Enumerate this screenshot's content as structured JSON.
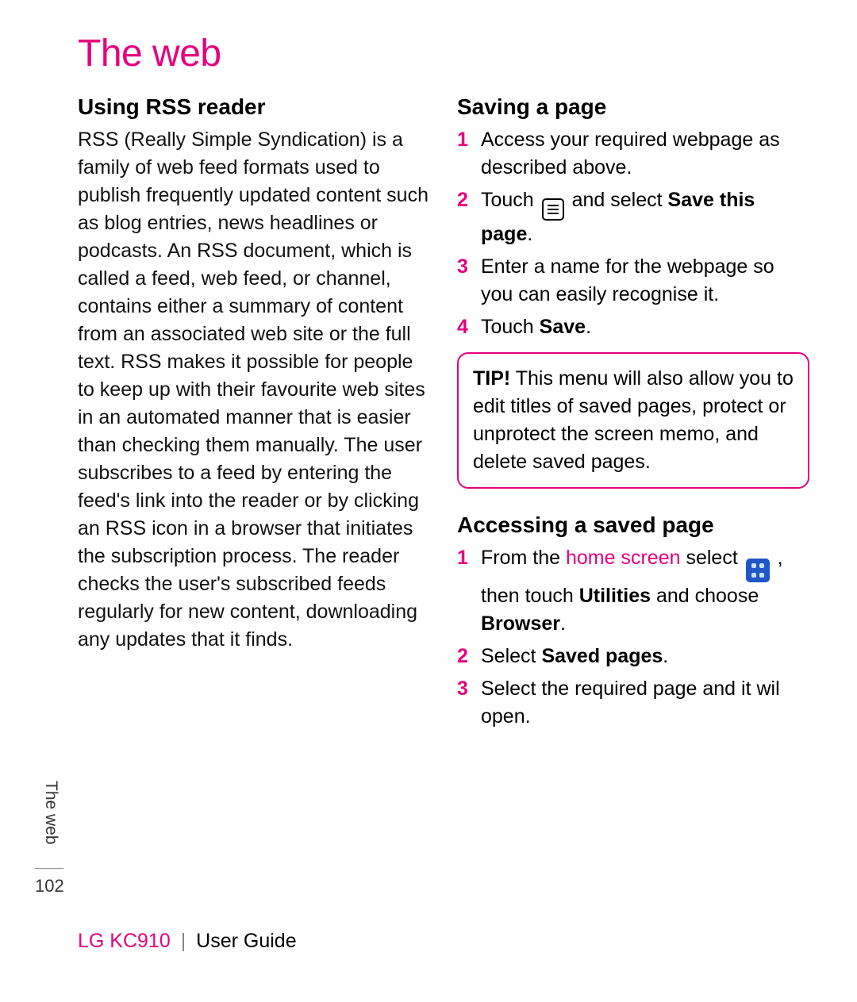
{
  "title": "The web",
  "side_label": "The web",
  "page_number": "102",
  "footer": {
    "model": "LG KC910",
    "separator": "|",
    "guide": "User Guide"
  },
  "left": {
    "heading": "Using RSS reader",
    "body": "RSS (Really Simple Syndication) is a family of web feed formats used to publish frequently updated content such as blog entries, news headlines or podcasts. An RSS document, which is called a feed, web feed, or channel, contains either a summary of content from an associated web site or the full text. RSS makes it possible for people to keep up with their favourite web sites in an automated manner that is easier than checking them manually. The user subscribes to a feed by entering the feed's link into the reader or by clicking an RSS icon in a browser that initiates the subscription process. The reader checks the user's subscribed feeds regularly for new content, downloading any updates that it finds."
  },
  "right": {
    "saving": {
      "heading": "Saving a page",
      "step1": "Access your required webpage as described above.",
      "step2_pre": "Touch ",
      "step2_mid": " and select ",
      "step2_bold": "Save this page",
      "step2_end": ".",
      "step3": "Enter a name for the webpage so you can easily recognise it.",
      "step4_pre": "Touch ",
      "step4_bold": "Save",
      "step4_end": "."
    },
    "tip": {
      "label": "TIP!",
      "text": " This menu will also allow you to edit titles of saved pages, protect or unprotect the screen memo, and delete saved pages."
    },
    "accessing": {
      "heading": "Accessing a saved page",
      "step1_pre": "From the ",
      "step1_pink": "home screen",
      "step1_mid": " select ",
      "step1_after_icon": " , then touch ",
      "step1_bold1": "Utilities",
      "step1_mid2": " and choose ",
      "step1_bold2": "Browser",
      "step1_end": ".",
      "step2_pre": "Select ",
      "step2_bold": "Saved pages",
      "step2_end": ".",
      "step3": "Select the required page and it wil open."
    }
  }
}
